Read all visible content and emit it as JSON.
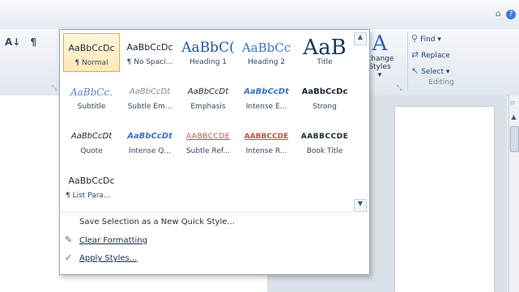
{
  "help_icons": [
    "minimize-ribbon-icon",
    "help-icon"
  ],
  "paragraph_group": {
    "sort_icon": "sort-icon",
    "pilcrow_icon": "show-formatting-icon",
    "sort_label": "A↓",
    "pilcrow_label": "¶"
  },
  "styles_gallery": {
    "rows": [
      [
        {
          "sample": "AaBbCcDc",
          "name": "¶ Normal",
          "style": "normal",
          "selected": true
        },
        {
          "sample": "AaBbCcDc",
          "name": "¶ No Spaci...",
          "style": "normal",
          "selected": false
        },
        {
          "sample": "AaBbC(",
          "name": "Heading 1",
          "style": "head",
          "selected": false
        },
        {
          "sample": "AaBbCc",
          "name": "Heading 2",
          "style": "head2",
          "selected": false
        },
        {
          "sample": "AaB",
          "name": "Title",
          "style": "title",
          "selected": false
        }
      ],
      [
        {
          "sample": "AaBbCc.",
          "name": "Subtitle",
          "style": "subtitle",
          "selected": false
        },
        {
          "sample": "AaBbCcDt",
          "name": "Subtle Em...",
          "style": "subtle",
          "selected": false
        },
        {
          "sample": "AaBbCcDt",
          "name": "Emphasis",
          "style": "emph",
          "selected": false
        },
        {
          "sample": "AaBbCcDt",
          "name": "Intense E...",
          "style": "intense",
          "selected": false
        },
        {
          "sample": "AaBbCcDc",
          "name": "Strong",
          "style": "strong",
          "selected": false
        }
      ],
      [
        {
          "sample": "AaBbCcDt",
          "name": "Quote",
          "style": "quote",
          "selected": false
        },
        {
          "sample": "AaBbCcDt",
          "name": "Intense Q...",
          "style": "iquote",
          "selected": false
        },
        {
          "sample": "AABBCCDE",
          "name": "Subtle Ref...",
          "style": "subref",
          "selected": false
        },
        {
          "sample": "AABBCCDE",
          "name": "Intense R...",
          "style": "intref",
          "selected": false
        },
        {
          "sample": "AABBCCDE",
          "name": "Book Title",
          "style": "book",
          "selected": false
        }
      ],
      [
        {
          "sample": "AaBbCcDc",
          "name": "¶ List Para...",
          "style": "normal",
          "selected": false
        }
      ]
    ],
    "scroll_up": "▲",
    "scroll_down": "▼"
  },
  "menu": {
    "save_selection": {
      "label": "Save Selection as a New Quick Style...",
      "icon": ""
    },
    "clear_formatting": {
      "label": "Clear Formatting",
      "icon": "clear-formatting-icon"
    },
    "apply_styles": {
      "label": "Apply Styles...",
      "icon": "apply-styles-icon"
    }
  },
  "change_styles": {
    "label_line1": "Change",
    "label_line2": "Styles ▾",
    "icon": "change-styles-icon"
  },
  "editing": {
    "find": "Find ▾",
    "replace": "Replace",
    "select": "Select ▾",
    "group_label": "Editing"
  },
  "colors": {
    "selected_tile_border": "#e3a94b",
    "heading_blue": "#1f53a6",
    "reference_red": "#c0504d"
  }
}
